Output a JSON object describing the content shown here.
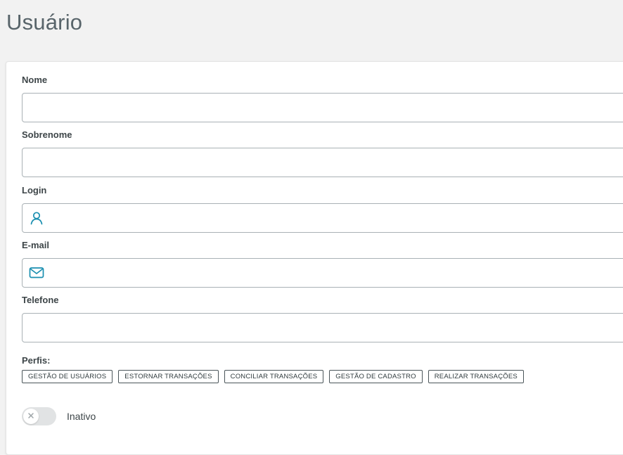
{
  "page": {
    "title": "Usuário"
  },
  "form": {
    "nome": {
      "label": "Nome",
      "value": "",
      "placeholder": ""
    },
    "sobrenome": {
      "label": "Sobrenome",
      "value": "",
      "placeholder": ""
    },
    "login": {
      "label": "Login",
      "value": "",
      "placeholder": "",
      "icon": "user-icon"
    },
    "email": {
      "label": "E-mail",
      "value": "",
      "placeholder": "",
      "icon": "mail-icon"
    },
    "telefone": {
      "label": "Telefone",
      "value": "",
      "placeholder": ""
    }
  },
  "profiles": {
    "label": "Perfis:",
    "items": [
      "GESTÃO DE USUÁRIOS",
      "ESTORNAR TRANSAÇÕES",
      "CONCILIAR TRANSAÇÕES",
      "GESTÃO DE CADASTRO",
      "REALIZAR TRANSAÇÕES"
    ]
  },
  "status": {
    "label": "Inativo",
    "active": false,
    "icon": "close-icon"
  },
  "colors": {
    "accent": "#1a8fb0",
    "background": "#f2f2f2",
    "card": "#ffffff"
  }
}
